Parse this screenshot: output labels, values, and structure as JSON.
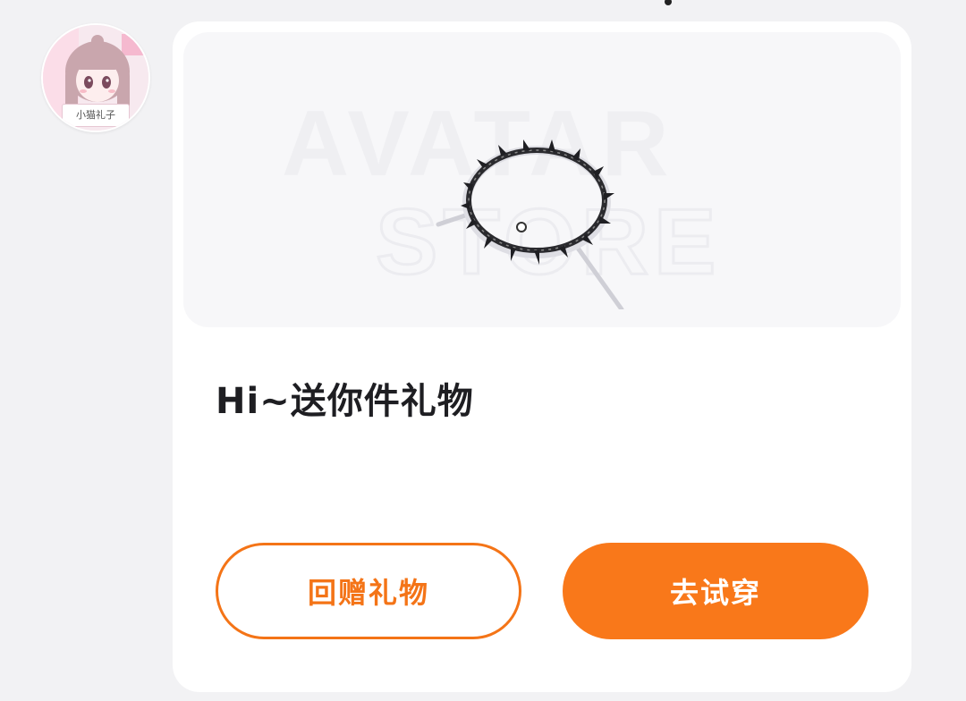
{
  "avatar": {
    "caption": "小猫礼子",
    "icon": "user-avatar"
  },
  "gift_card": {
    "watermark_line1": "AVATAR",
    "watermark_line2": "STORE",
    "item_icon": "spiked-choker-icon",
    "title": "Hi~送你件礼物",
    "message": "",
    "buttons": {
      "return_gift": "回赠礼物",
      "try_on": "去试穿"
    }
  },
  "colors": {
    "accent": "#f9781a",
    "accent_outline": "#f47417",
    "card_bg": "#ffffff",
    "panel_bg": "#f7f7f9",
    "page_bg": "#f2f2f4"
  }
}
